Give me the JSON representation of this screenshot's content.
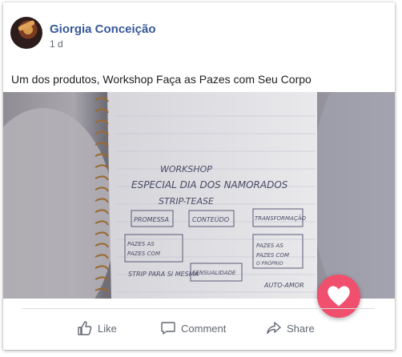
{
  "post": {
    "author": "Giorgia Conceição",
    "time": "1 d",
    "caption": "Um dos produtos, Workshop Faça as Pazes com Seu Corpo"
  },
  "photo": {
    "notebook": {
      "title_line1": "WORKSHOP",
      "title_line2": "ESPECIAL DIA DOS NAMORADOS",
      "title_line3": "STRIP-TEASE",
      "boxes": [
        "PROMESSA",
        "CONTEÚDO",
        "TRANSFORMAÇÃO",
        "PAZES AS PAZES COM O CORPO",
        "PAZES AS PAZES COM O PRÓPRIO CORPO",
        "STRIP PARA SI MESMA",
        "SENSUALIDADE",
        "AUTO-AMOR"
      ]
    }
  },
  "actions": {
    "like": "Like",
    "comment": "Comment",
    "share": "Share"
  },
  "colors": {
    "author": "#365899",
    "heart_fab": "#f0506e"
  }
}
